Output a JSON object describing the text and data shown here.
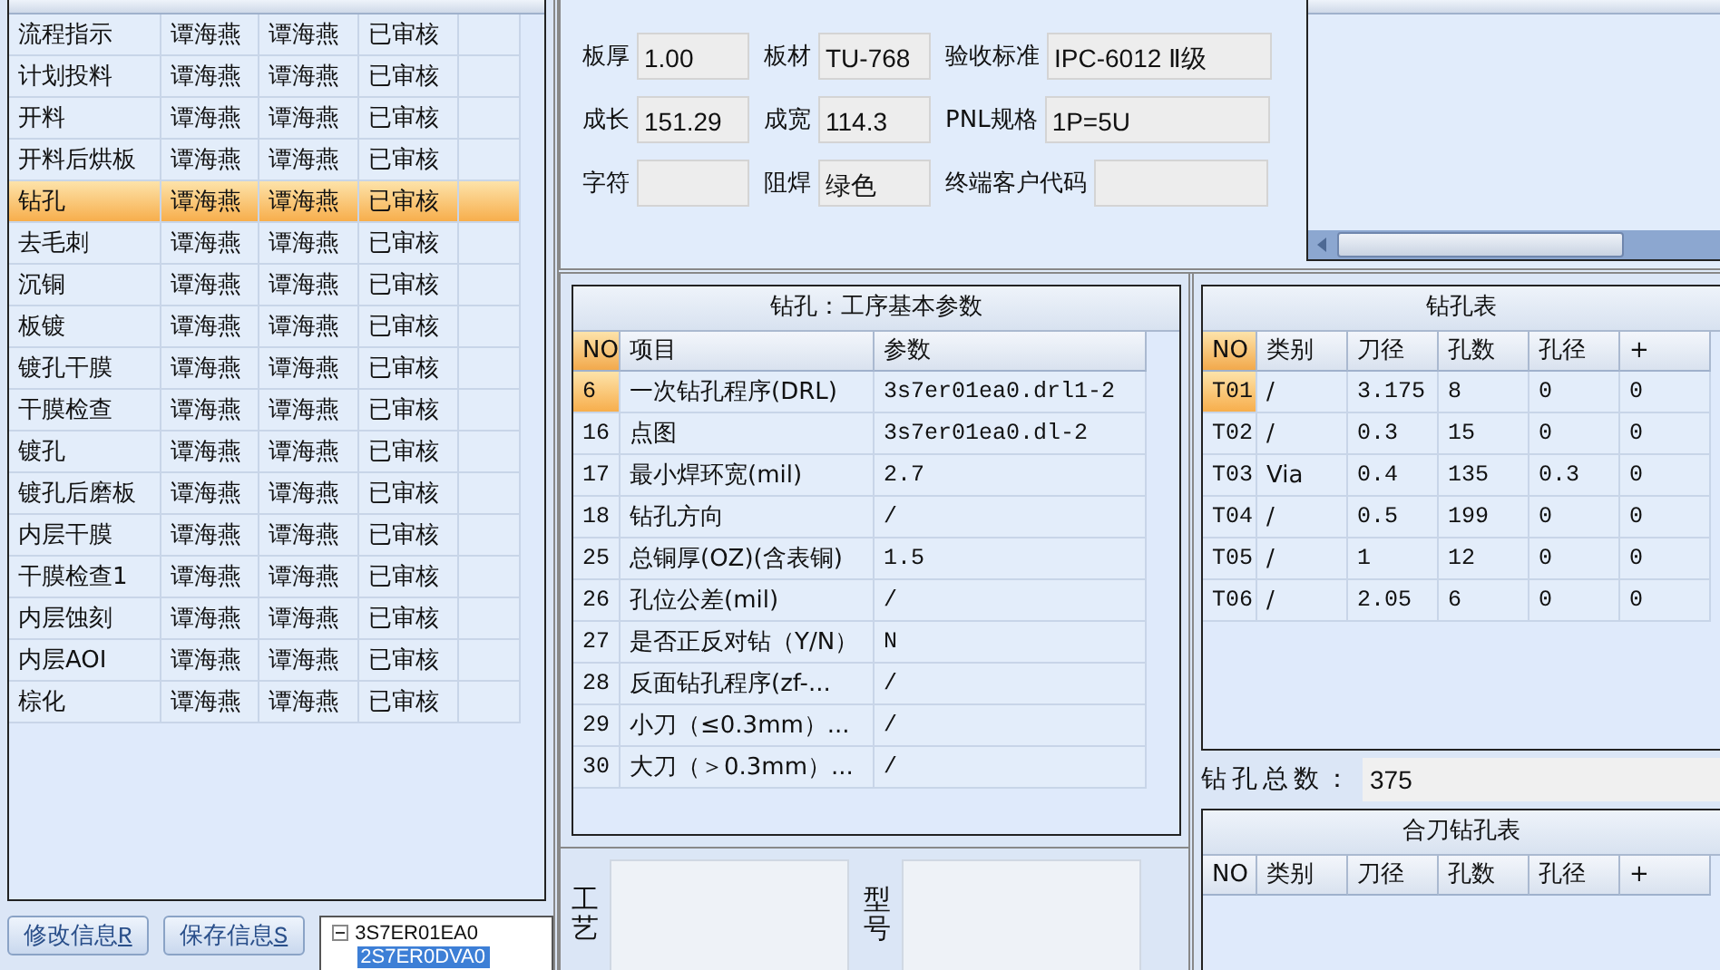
{
  "process_table": {
    "rows": [
      {
        "cells": [
          "流程指示",
          "谭海燕",
          "谭海燕",
          "已审核"
        ],
        "selected": false
      },
      {
        "cells": [
          "计划投料",
          "谭海燕",
          "谭海燕",
          "已审核"
        ],
        "selected": false
      },
      {
        "cells": [
          "开料",
          "谭海燕",
          "谭海燕",
          "已审核"
        ],
        "selected": false
      },
      {
        "cells": [
          "开料后烘板",
          "谭海燕",
          "谭海燕",
          "已审核"
        ],
        "selected": false
      },
      {
        "cells": [
          "钻孔",
          "谭海燕",
          "谭海燕",
          "已审核"
        ],
        "selected": true
      },
      {
        "cells": [
          "去毛刺",
          "谭海燕",
          "谭海燕",
          "已审核"
        ],
        "selected": false
      },
      {
        "cells": [
          "沉铜",
          "谭海燕",
          "谭海燕",
          "已审核"
        ],
        "selected": false
      },
      {
        "cells": [
          "板镀",
          "谭海燕",
          "谭海燕",
          "已审核"
        ],
        "selected": false
      },
      {
        "cells": [
          "镀孔干膜",
          "谭海燕",
          "谭海燕",
          "已审核"
        ],
        "selected": false
      },
      {
        "cells": [
          "干膜检查",
          "谭海燕",
          "谭海燕",
          "已审核"
        ],
        "selected": false
      },
      {
        "cells": [
          "镀孔",
          "谭海燕",
          "谭海燕",
          "已审核"
        ],
        "selected": false
      },
      {
        "cells": [
          "镀孔后磨板",
          "谭海燕",
          "谭海燕",
          "已审核"
        ],
        "selected": false
      },
      {
        "cells": [
          "内层干膜",
          "谭海燕",
          "谭海燕",
          "已审核"
        ],
        "selected": false
      },
      {
        "cells": [
          "干膜检查1",
          "谭海燕",
          "谭海燕",
          "已审核"
        ],
        "selected": false
      },
      {
        "cells": [
          "内层蚀刻",
          "谭海燕",
          "谭海燕",
          "已审核"
        ],
        "selected": false
      },
      {
        "cells": [
          "内层AOI",
          "谭海燕",
          "谭海燕",
          "已审核"
        ],
        "selected": false
      },
      {
        "cells": [
          "棕化",
          "谭海燕",
          "谭海燕",
          "已审核"
        ],
        "selected": false
      }
    ]
  },
  "buttons": [
    {
      "label": "修改信息",
      "hotkey": "R"
    },
    {
      "label": "保存信息",
      "hotkey": "S"
    }
  ],
  "tree": {
    "label": "3S7ER01EA0",
    "expanded": true,
    "children": [
      {
        "label": "2S7ER0DVA0",
        "selected": true
      }
    ]
  },
  "board_fields": [
    [
      {
        "label": "板厚",
        "value": "1.00"
      },
      {
        "label": "板材",
        "value": "TU-768"
      },
      {
        "label": "验收标准",
        "value": "IPC-6012 Ⅱ级"
      }
    ],
    [
      {
        "label": "成长",
        "value": "151.29"
      },
      {
        "label": "成宽",
        "value": "114.3"
      },
      {
        "label": "PNL规格",
        "value": "1P=5U"
      }
    ],
    [
      {
        "label": "字符"
      },
      {
        "label": "阻焊",
        "value": "绿色"
      },
      {
        "label": "终端客户代码"
      }
    ]
  ],
  "params_panel": {
    "title": "钻孔：工序基本参数",
    "columns": [
      "NO",
      "项目",
      "参数"
    ],
    "rows": [
      {
        "cells": [
          "6",
          "一次钻孔程序(DRL)",
          "3s7er01ea0.drl1-2"
        ],
        "selected": true
      },
      {
        "cells": [
          "16",
          "点图",
          "3s7er01ea0.dl-2"
        ],
        "selected": false
      },
      {
        "cells": [
          "17",
          "最小焊环宽(mil)",
          "2.7"
        ],
        "selected": false
      },
      {
        "cells": [
          "18",
          "钻孔方向",
          "/"
        ],
        "selected": false
      },
      {
        "cells": [
          "25",
          "总铜厚(OZ)(含表铜)",
          "1.5"
        ],
        "selected": false
      },
      {
        "cells": [
          "26",
          "孔位公差(mil)",
          "/"
        ],
        "selected": false
      },
      {
        "cells": [
          "27",
          "是否正反对钻（Y/N）",
          "N"
        ],
        "selected": false
      },
      {
        "cells": [
          "28",
          "反面钻孔程序(zf-...",
          "/"
        ],
        "selected": false
      },
      {
        "cells": [
          "29",
          "小刀（≤0.3mm）...",
          "/"
        ],
        "selected": false
      },
      {
        "cells": [
          "30",
          "大刀（＞0.3mm）...",
          "/"
        ],
        "selected": false
      }
    ]
  },
  "notes": [
    {
      "label": "工艺"
    },
    {
      "label": "型号"
    }
  ],
  "drill_table": {
    "title": "钻孔表",
    "columns": [
      "NO",
      "类别",
      "刀径",
      "孔数",
      "孔径",
      "+"
    ],
    "rows": [
      {
        "cells": [
          "T01",
          "/",
          "3.175",
          "8",
          "0",
          "0"
        ],
        "selected": true
      },
      {
        "cells": [
          "T02",
          "/",
          "0.3",
          "15",
          "0",
          "0"
        ],
        "selected": false
      },
      {
        "cells": [
          "T03",
          "Via",
          "0.4",
          "135",
          "0.3",
          "0"
        ],
        "selected": false
      },
      {
        "cells": [
          "T04",
          "/",
          "0.5",
          "199",
          "0",
          "0"
        ],
        "selected": false
      },
      {
        "cells": [
          "T05",
          "/",
          "1",
          "12",
          "0",
          "0"
        ],
        "selected": false
      },
      {
        "cells": [
          "T06",
          "/",
          "2.05",
          "6",
          "0",
          "0"
        ],
        "selected": false
      }
    ]
  },
  "drill_total": {
    "label": "钻孔总数：",
    "value": "375"
  },
  "combined_table": {
    "title": "合刀钻孔表",
    "columns": [
      "NO",
      "类别",
      "刀径",
      "孔数",
      "孔径",
      "+"
    ]
  }
}
